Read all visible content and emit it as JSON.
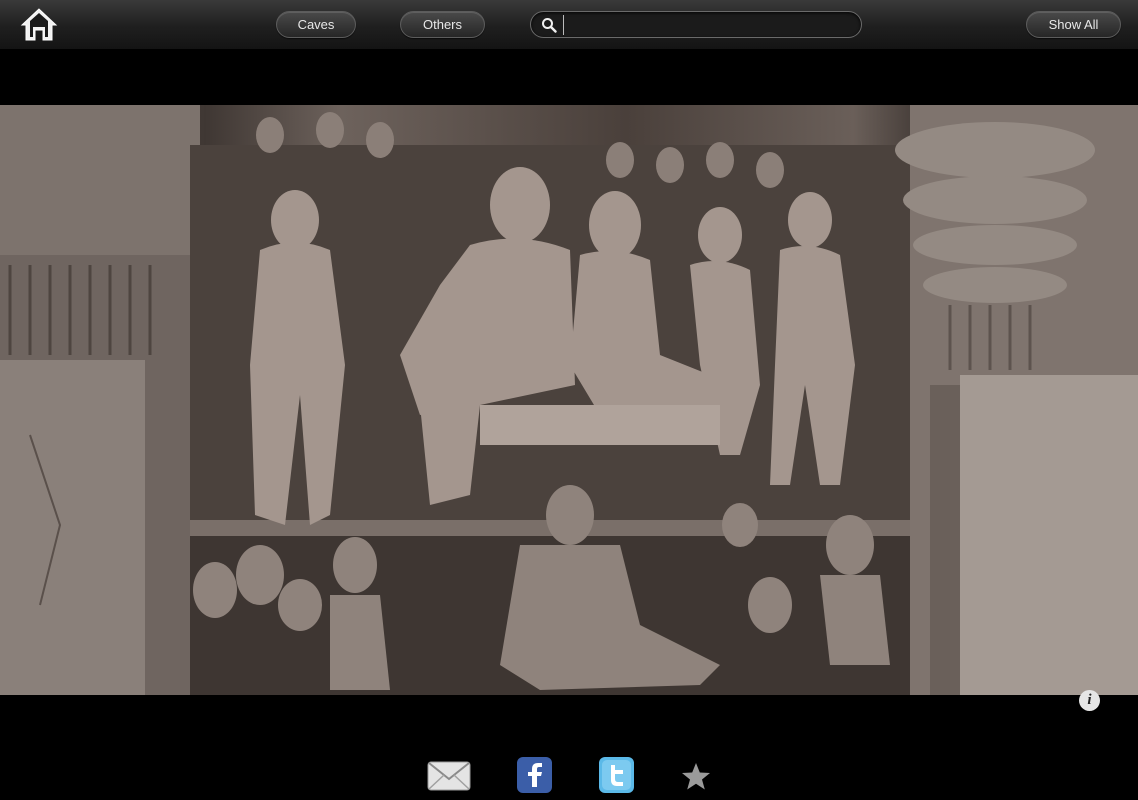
{
  "toolbar": {
    "home_icon": "home-icon",
    "caves_label": "Caves",
    "others_label": "Others",
    "show_all_label": "Show All",
    "search": {
      "icon": "search-icon",
      "value": "",
      "placeholder": ""
    }
  },
  "photo": {
    "subject": "rock-cut-relief-sculpture",
    "colors": {
      "stone_dark": "#3f3733",
      "stone_light": "#9a9088"
    }
  },
  "info_button": {
    "label": "i"
  },
  "share": {
    "icons": [
      "mail-icon",
      "facebook-icon",
      "twitter-icon",
      "star-icon"
    ]
  }
}
